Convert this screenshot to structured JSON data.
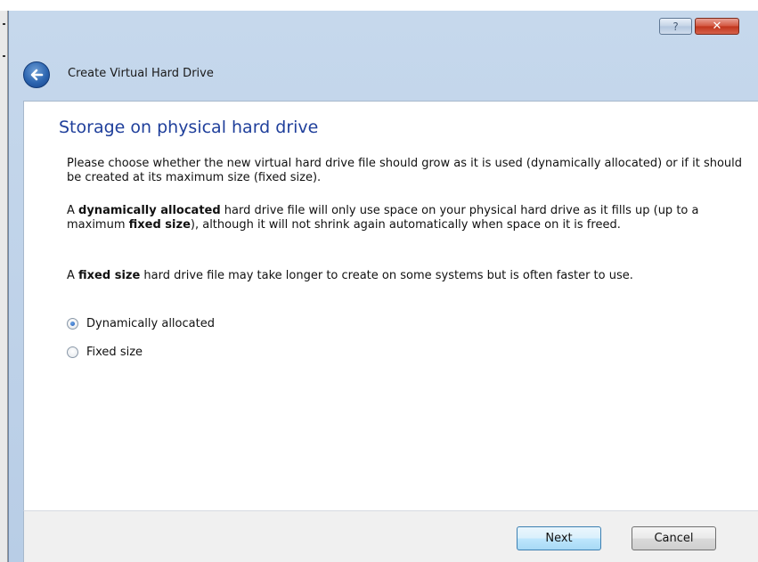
{
  "window": {
    "nav_title": "Create Virtual Hard Drive",
    "help_button_glyph": "?",
    "close_button_glyph": "✕"
  },
  "page": {
    "heading": "Storage on physical hard drive",
    "paragraph1": "Please choose whether the new virtual hard drive file should grow as it is used (dynamically allocated) or if it should be created at its maximum size (fixed size).",
    "paragraph2": {
      "t1": "A ",
      "b1": "dynamically allocated",
      "t2": " hard drive file will only use space on your physical hard drive as it fills up (up to a maximum ",
      "b2": "fixed size",
      "t3": "), although it will not shrink again automatically when space on it is freed."
    },
    "paragraph3": {
      "t1": "A ",
      "b1": "fixed size",
      "t2": " hard drive file may take longer to create on some systems but is often faster to use."
    }
  },
  "options": [
    {
      "label": "Dynamically allocated",
      "selected": true
    },
    {
      "label": "Fixed size",
      "selected": false
    }
  ],
  "buttons": {
    "next": "Next",
    "cancel": "Cancel"
  },
  "icons": {
    "back": "back-arrow-icon",
    "help": "help-icon",
    "close": "close-icon"
  },
  "colors": {
    "heading": "#1f3f9b",
    "titlebar": "#c6d8ec",
    "close_button": "#c0341b"
  }
}
